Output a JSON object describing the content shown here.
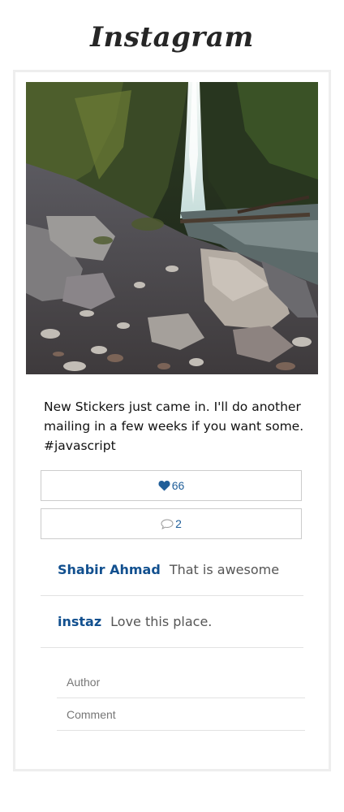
{
  "app": {
    "logo_text": "Instagram"
  },
  "post": {
    "image_alt": "waterfall and rocky creek photo",
    "caption": "New Stickers just came in. I'll do another mailing in a few weeks if you want some. #javascript",
    "likes": "66",
    "comment_count": "2"
  },
  "comments": [
    {
      "author": "Shabir Ahmad",
      "text": "That is awesome"
    },
    {
      "author": "instaz",
      "text": "Love this place."
    }
  ],
  "form": {
    "author_placeholder": "Author",
    "comment_placeholder": "Comment"
  },
  "colors": {
    "link_blue": "#12508f",
    "heart": "#1f5e99"
  },
  "icons": {
    "like": "heart-icon",
    "comment": "speech-bubble-icon"
  }
}
